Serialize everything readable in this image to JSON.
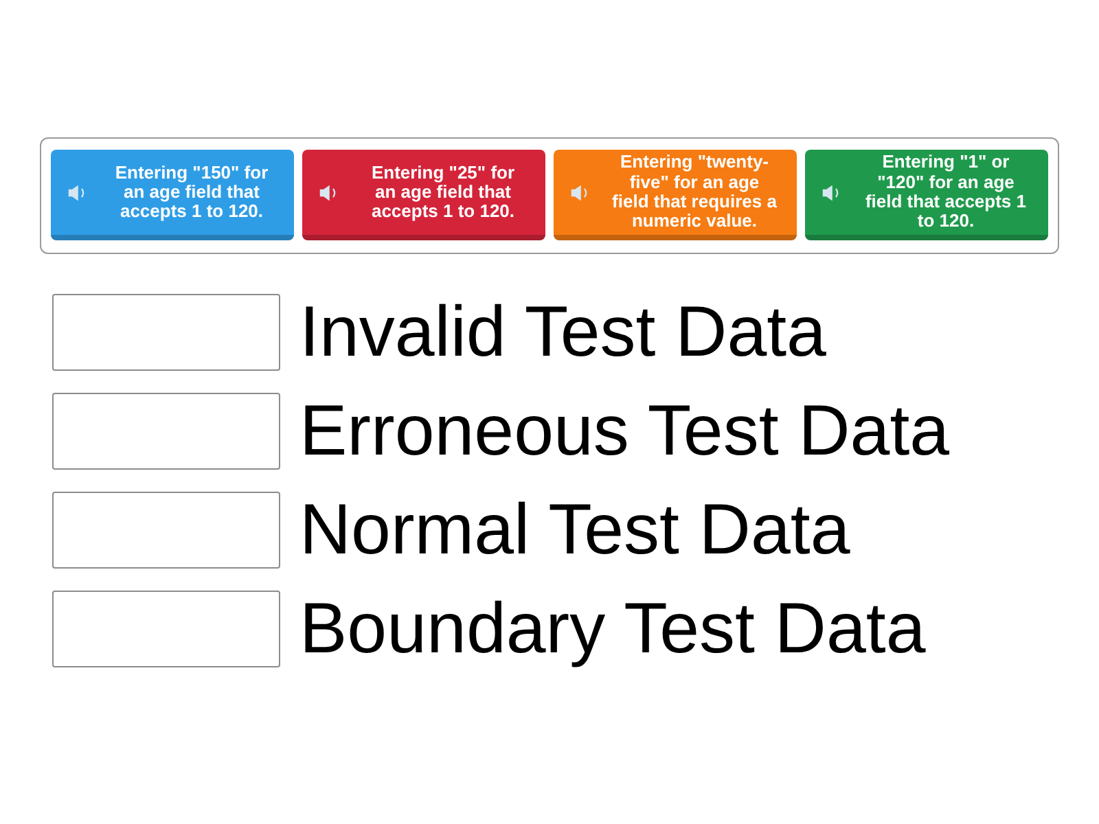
{
  "cards": [
    {
      "text": "Entering \"150\" for an age field that accepts 1 to 120.",
      "color": "#2f9de6"
    },
    {
      "text": "Entering \"25\" for an age field that accepts 1 to 120.",
      "color": "#d4243a"
    },
    {
      "text": "Entering \"twenty-five\" for an age field that requires a numeric value.",
      "color": "#f57b12"
    },
    {
      "text": "Entering \"1\" or \"120\" for an age field that accepts 1 to 120.",
      "color": "#1f9a4c"
    }
  ],
  "targets": [
    {
      "label": "Invalid Test Data"
    },
    {
      "label": "Erroneous Test Data"
    },
    {
      "label": "Normal Test Data"
    },
    {
      "label": "Boundary Test Data"
    }
  ]
}
